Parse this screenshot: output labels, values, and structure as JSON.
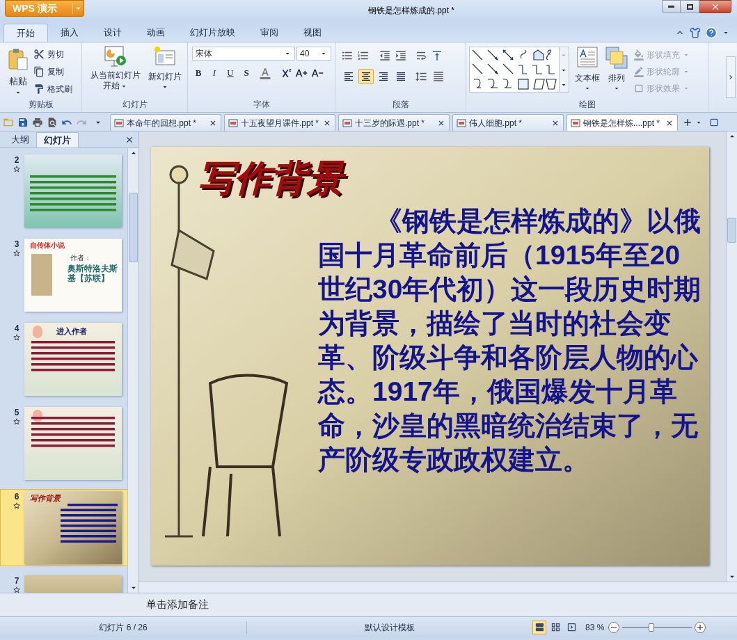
{
  "app_button": {
    "label": "WPS 演示"
  },
  "window": {
    "title": "钢铁是怎样炼成的.ppt *"
  },
  "menu_tabs": [
    {
      "label": "开始",
      "selected": true
    },
    {
      "label": "插入",
      "selected": false
    },
    {
      "label": "设计",
      "selected": false
    },
    {
      "label": "动画",
      "selected": false
    },
    {
      "label": "幻灯片放映",
      "selected": false
    },
    {
      "label": "审阅",
      "selected": false
    },
    {
      "label": "视图",
      "selected": false
    }
  ],
  "ribbon": {
    "clipboard": {
      "paste": "粘贴",
      "items": [
        {
          "kind": "cut",
          "label": "剪切"
        },
        {
          "kind": "copy",
          "label": "复制"
        },
        {
          "kind": "format",
          "label": "格式刷"
        }
      ],
      "label": "剪贴板"
    },
    "slides": {
      "play_lines": [
        "从当前幻灯片",
        "开始"
      ],
      "new_slide": "新幻灯片",
      "label": "幻灯片"
    },
    "font": {
      "name": "宋体",
      "size": "40",
      "styles": [
        "B",
        "I",
        "U",
        "S"
      ],
      "label": "字体"
    },
    "paragraph": {
      "align": [
        {
          "kind": "left",
          "selected": false
        },
        {
          "kind": "center",
          "selected": true
        },
        {
          "kind": "right",
          "selected": false
        },
        {
          "kind": "justify",
          "selected": false
        }
      ],
      "label": "段落"
    },
    "drawing": {
      "text_box": "文本框",
      "arrange": "排列",
      "shape_tools": [
        {
          "kind": "fill",
          "label": "形状填充",
          "disabled": true
        },
        {
          "kind": "outline",
          "label": "形状轮廓",
          "disabled": true
        },
        {
          "kind": "effect",
          "label": "形状效果",
          "disabled": true
        }
      ],
      "label": "绘图"
    }
  },
  "doc_tabs": [
    {
      "label": "本命年的回想.ppt *",
      "selected": false
    },
    {
      "label": "十五夜望月课件.ppt *",
      "selected": false
    },
    {
      "label": "十三岁的际遇.ppt *",
      "selected": false
    },
    {
      "label": "伟人细胞.ppt *",
      "selected": false
    },
    {
      "label": "钢铁是怎样炼....ppt *",
      "selected": true
    }
  ],
  "side_panel": {
    "tabs": [
      {
        "label": "大纲",
        "selected": false
      },
      {
        "label": "幻灯片",
        "selected": true
      }
    ],
    "thumbnails": [
      {
        "number": "2",
        "selected": false,
        "kind": "green"
      },
      {
        "number": "3",
        "selected": false,
        "kind": "book",
        "texts": [
          "自传体小说",
          "作者：",
          "奥斯特洛夫斯基【苏联】"
        ]
      },
      {
        "number": "4",
        "selected": false,
        "kind": "balloon",
        "texts": [
          "进入作者"
        ]
      },
      {
        "number": "5",
        "selected": false,
        "kind": "balloon"
      },
      {
        "number": "6",
        "selected": true,
        "kind": "current",
        "texts": [
          "写作背景"
        ]
      },
      {
        "number": "7",
        "selected": false,
        "kind": "dark"
      }
    ]
  },
  "slide": {
    "title": "写作背景",
    "body": "《钢铁是怎样炼成的》以俄国十月革命前后（1915年至20世纪30年代初）这一段历史时期为背景，描绘了当时的社会变革、阶级斗争和各阶层人物的心态。1917年，俄国爆发十月革命，沙皇的黑暗统治结束了，无产阶级专政政权建立。"
  },
  "notes": {
    "placeholder": "单击添加备注"
  },
  "status_bar": {
    "slide_counter": "幻灯片 6 / 26",
    "template": "默认设计模板",
    "views": [
      {
        "kind": "normal",
        "selected": true
      },
      {
        "kind": "sorter",
        "selected": false
      },
      {
        "kind": "show",
        "selected": false
      }
    ],
    "zoom": "83 %",
    "zoom_slider": {
      "level": 0.42
    }
  }
}
